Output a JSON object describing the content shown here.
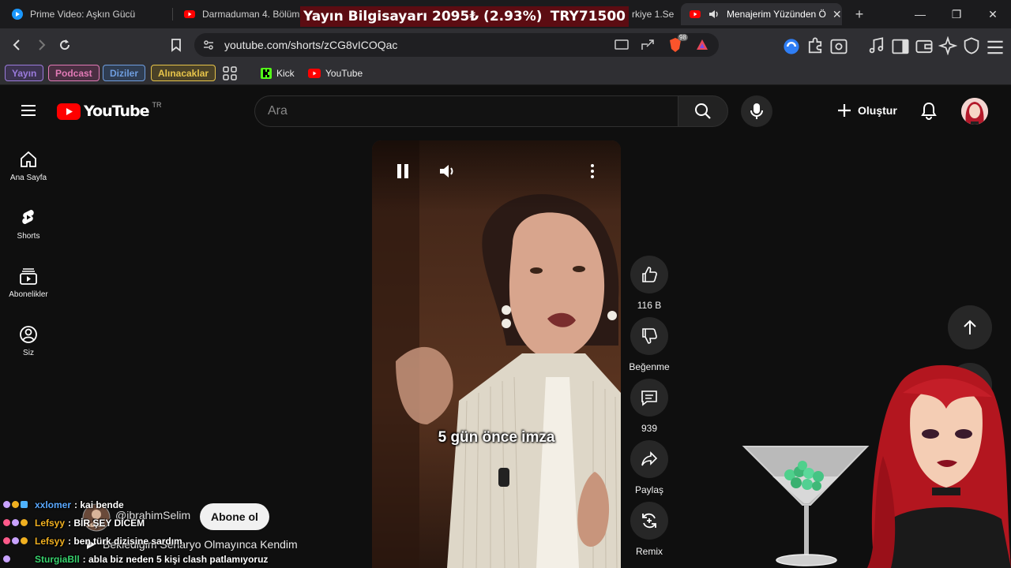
{
  "browser": {
    "tabs": [
      {
        "title": "Prime Video: Aşkın Gücü"
      },
      {
        "title": "Darmaduman 4. Bölüm"
      },
      {
        "title": "rkiye 1.Se"
      },
      {
        "title": "Menajerim Yüzünden Ö",
        "active": true
      }
    ],
    "overlay_banner": {
      "left": "Yayın Bilgisayarı  2095₺ (2.93%)",
      "right": "TRY71500"
    },
    "url": "youtube.com/shorts/zCG8vICOQac",
    "extension_badge": "98",
    "bookmarks": [
      {
        "label": "Yayın",
        "color": "#9b7bdc"
      },
      {
        "label": "Podcast",
        "color": "#e27ab6"
      },
      {
        "label": "Diziler",
        "color": "#6f9ee0"
      },
      {
        "label": "Alınacaklar",
        "color": "#e7c44a"
      }
    ],
    "bookmark_links": [
      {
        "label": "Kick",
        "icon": "kick-icon"
      },
      {
        "label": "YouTube",
        "icon": "youtube-icon"
      }
    ]
  },
  "youtube": {
    "logo_text": "YouTube",
    "region": "TR",
    "search_placeholder": "Ara",
    "create_label": "Oluştur",
    "sidebar": [
      {
        "label": "Ana Sayfa",
        "icon": "home-icon"
      },
      {
        "label": "Shorts",
        "icon": "shorts-icon"
      },
      {
        "label": "Abonelikler",
        "icon": "subscriptions-icon"
      },
      {
        "label": "Siz",
        "icon": "user-icon"
      }
    ],
    "short": {
      "caption": "5 gün önce imza",
      "channel": "@ibrahimSelim",
      "subscribe_label": "Abone ol",
      "title": "Beklediğim Senaryo Olmayınca Kendim"
    },
    "actions": {
      "like_count": "116 B",
      "dislike_label": "Beğenme",
      "comment_count": "939",
      "share_label": "Paylaş",
      "remix_label": "Remix"
    }
  },
  "chat": [
    {
      "user": "xxlomer",
      "color": "#5aa9ff",
      "message": ": kai bende"
    },
    {
      "user": "Lefsyy",
      "color": "#f0b020",
      "message": ": BİR ŞEY DİCEM"
    },
    {
      "user": "Lefsyy",
      "color": "#f0b020",
      "message": ": ben türk dizisine sardım"
    },
    {
      "user": "SturgiaBll",
      "color": "#38d36e",
      "message": ": abla biz neden 5 kişi clash patlamıyoruz"
    }
  ],
  "colors": {
    "accent": "#ff0000",
    "background": "#0f0f0f",
    "banner": "#5c0c12"
  }
}
